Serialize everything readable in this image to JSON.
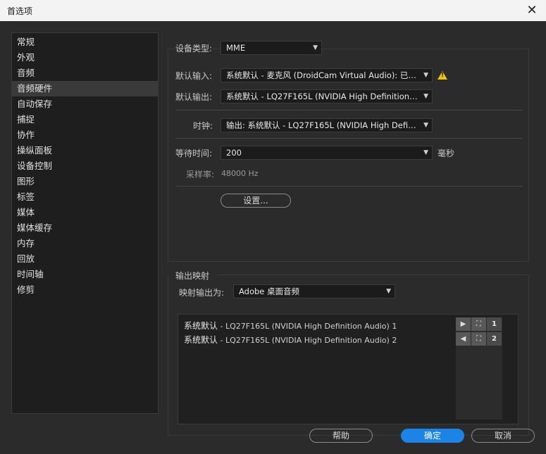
{
  "window": {
    "title": "首选项",
    "close_glyph": "✕"
  },
  "sidebar": {
    "items": [
      {
        "label": "常规"
      },
      {
        "label": "外观"
      },
      {
        "label": "音频"
      },
      {
        "label": "音频硬件"
      },
      {
        "label": "自动保存"
      },
      {
        "label": "捕捉"
      },
      {
        "label": "协作"
      },
      {
        "label": "操纵面板"
      },
      {
        "label": "设备控制"
      },
      {
        "label": "图形"
      },
      {
        "label": "标签"
      },
      {
        "label": "媒体"
      },
      {
        "label": "媒体缓存"
      },
      {
        "label": "内存"
      },
      {
        "label": "回放"
      },
      {
        "label": "时间轴"
      },
      {
        "label": "修剪"
      }
    ],
    "selected": "音频硬件"
  },
  "hardware": {
    "device_type_label": "设备类型:",
    "device_type_value": "MME",
    "default_input_label": "默认输入:",
    "default_input_value": "系统默认 - 麦克风 (DroidCam Virtual Audio): 已…",
    "default_input_warning": true,
    "warning_glyph": "!",
    "default_output_label": "默认输出:",
    "default_output_value": "系统默认 - LQ27F165L (NVIDIA High Definition Aud…",
    "clock_label": "时钟:",
    "clock_value": "输出: 系统默认 - LQ27F165L (NVIDIA High Definiti…",
    "latency_label": "等待时间:",
    "latency_value": "200",
    "latency_unit": "毫秒",
    "sample_rate_label": "采样率:",
    "sample_rate_value": "48000 Hz",
    "settings_button": "设置..."
  },
  "output_mapping": {
    "section_label": "输出映射",
    "map_output_label": "映射输出为:",
    "map_output_value": "Adobe 桌面音频",
    "rows": [
      {
        "prefix": "系统默认",
        "detail": " - LQ27F165L (NVIDIA High Definition Audio) 1",
        "channel": "1"
      },
      {
        "prefix": "系统默认",
        "detail": " - LQ27F165L (NVIDIA High Definition Audio) 2",
        "channel": "2"
      }
    ],
    "icons": [
      "play-icon",
      "speaker-icon",
      "frame-icon"
    ]
  },
  "footer": {
    "help": "帮助",
    "ok": "确定",
    "cancel": "取消"
  },
  "colors": {
    "accent": "#1b84e6",
    "warning": "#f2c100",
    "background": "#2b2b2b"
  }
}
